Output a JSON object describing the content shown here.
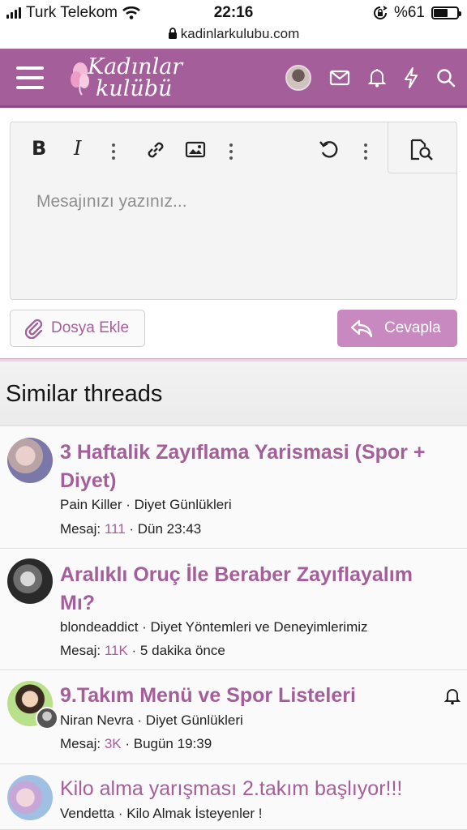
{
  "statusbar": {
    "carrier": "Turk Telekom",
    "time": "22:16",
    "battery": "%61",
    "battery_level": 0.61
  },
  "browser": {
    "url": "kadinlarkulubu.com"
  },
  "header": {
    "logo_line1": "Kadınlar",
    "logo_line2": "kulübü",
    "brand_color": "#a45f9a"
  },
  "editor": {
    "placeholder": "Mesajınızı yazınız..."
  },
  "buttons": {
    "attach": "Dosya Ekle",
    "reply": "Cevapla"
  },
  "similar": {
    "title": "Similar threads",
    "threads": [
      {
        "title": "3 Haftalik Zayıflama Yarismasi (Spor + Diyet)",
        "meta": "Pain Killer · Diyet Günlükleri",
        "stats_label": "Mesaj:",
        "count": "111",
        "when": "· Dün 23:43"
      },
      {
        "title": "Aralıklı Oruç İle Beraber Zayıflayalım Mı?",
        "meta": "blondeaddict · Diyet Yöntemleri ve Deneyimlerimiz",
        "stats_label": "Mesaj:",
        "count": "11K",
        "when": "· 5 dakika önce"
      },
      {
        "title": "9.Takım Menü ve Spor Listeleri",
        "meta": "Niran Nevra · Diyet Günlükleri",
        "stats_label": "Mesaj:",
        "count": "3K",
        "when": "· Bugün 19:39"
      },
      {
        "title": "Kilo alma yarışması 2.takım başlıyor!!!",
        "meta": "Vendetta · Kilo Almak İsteyenler !"
      }
    ]
  }
}
